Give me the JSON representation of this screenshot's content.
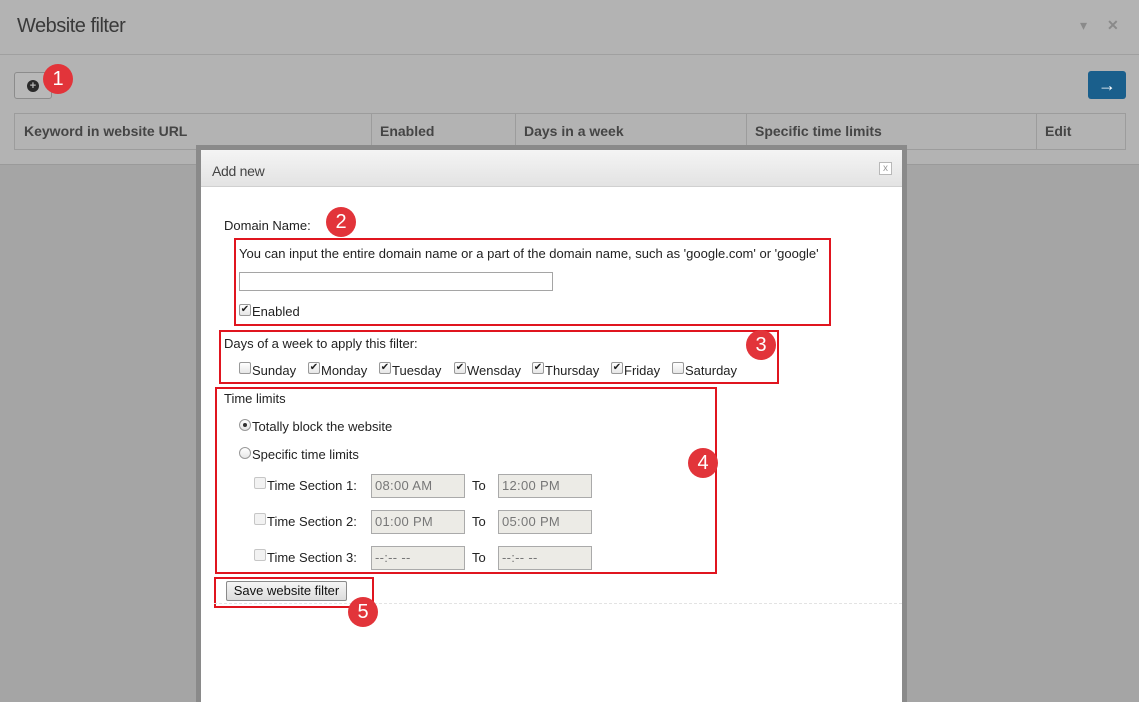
{
  "panel": {
    "title": "Website filter",
    "collapse_icon": "caret-down-icon",
    "close_icon": "close-icon",
    "add_icon": "plus-circle-icon",
    "next_icon": "arrow-right-icon",
    "columns": [
      "Keyword in website URL",
      "Enabled",
      "Days in a week",
      "Specific time limits",
      "Edit"
    ]
  },
  "markers": [
    "1",
    "2",
    "3",
    "4",
    "5"
  ],
  "modal": {
    "title": "Add new",
    "close_label": "x",
    "domain_label": "Domain Name:",
    "domain_hint": "You can input the entire domain name or a part of the domain name, such as 'google.com' or 'google'",
    "domain_value": "",
    "enabled_label": "Enabled",
    "enabled_checked": true,
    "days_label": "Days of a week to apply this filter:",
    "days": [
      {
        "label": "Sunday",
        "checked": false
      },
      {
        "label": "Monday",
        "checked": true
      },
      {
        "label": "Tuesday",
        "checked": true
      },
      {
        "label": "Wensday",
        "checked": true
      },
      {
        "label": "Thursday",
        "checked": true
      },
      {
        "label": "Friday",
        "checked": true
      },
      {
        "label": "Saturday",
        "checked": false
      }
    ],
    "time_limits_label": "Time limits",
    "block_label": "Totally block the website",
    "specific_label": "Specific time limits",
    "to_label": "To",
    "sections": [
      {
        "label": "Time Section 1:",
        "from": "08:00 AM",
        "to": "12:00 PM"
      },
      {
        "label": "Time Section 2:",
        "from": "01:00 PM",
        "to": "05:00 PM"
      },
      {
        "label": "Time Section 3:",
        "from": "--:-- --",
        "to": "--:-- --"
      }
    ],
    "save_label": "Save website filter"
  },
  "colors": {
    "accent": "#1a5f8c",
    "marker": "#e2343a",
    "highlight": "#e0151f"
  }
}
